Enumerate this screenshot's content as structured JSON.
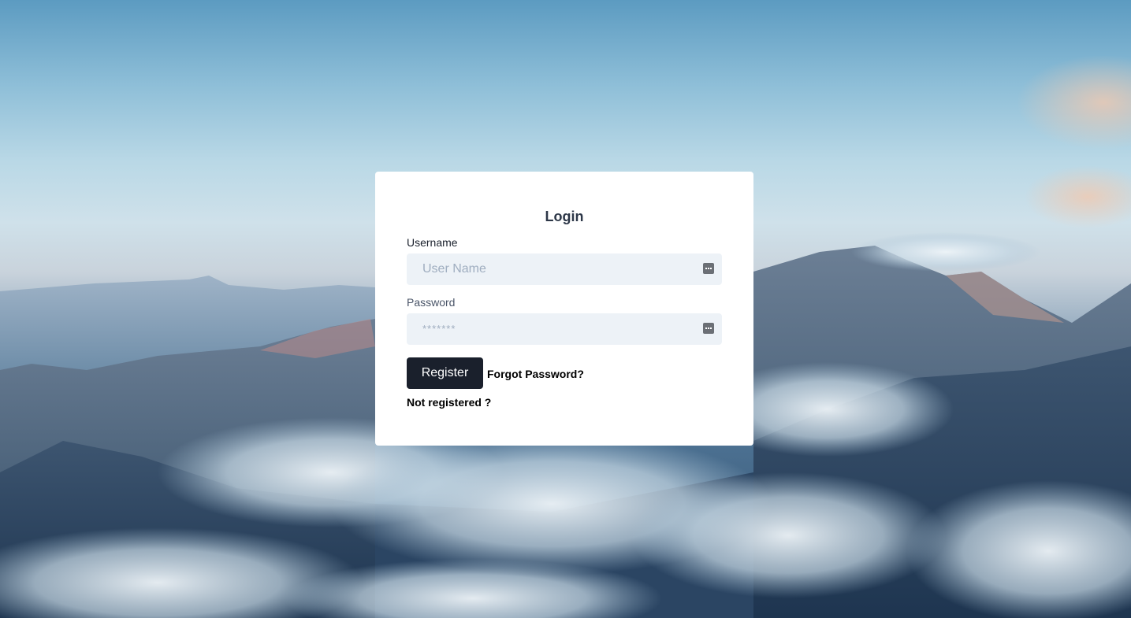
{
  "login": {
    "title": "Login",
    "username_label": "Username",
    "username_placeholder": "User Name",
    "username_value": "",
    "password_label": "Password",
    "password_placeholder": "*******",
    "password_value": "",
    "field_icon": "password-manager-icon",
    "register_label": "Register",
    "forgot_label": "Forgot Password?",
    "not_registered_label": "Not registered ?"
  },
  "colors": {
    "card_bg": "#ffffff",
    "input_bg": "#edf2f7",
    "button_bg": "#1a202c",
    "title_color": "#2d3748"
  }
}
